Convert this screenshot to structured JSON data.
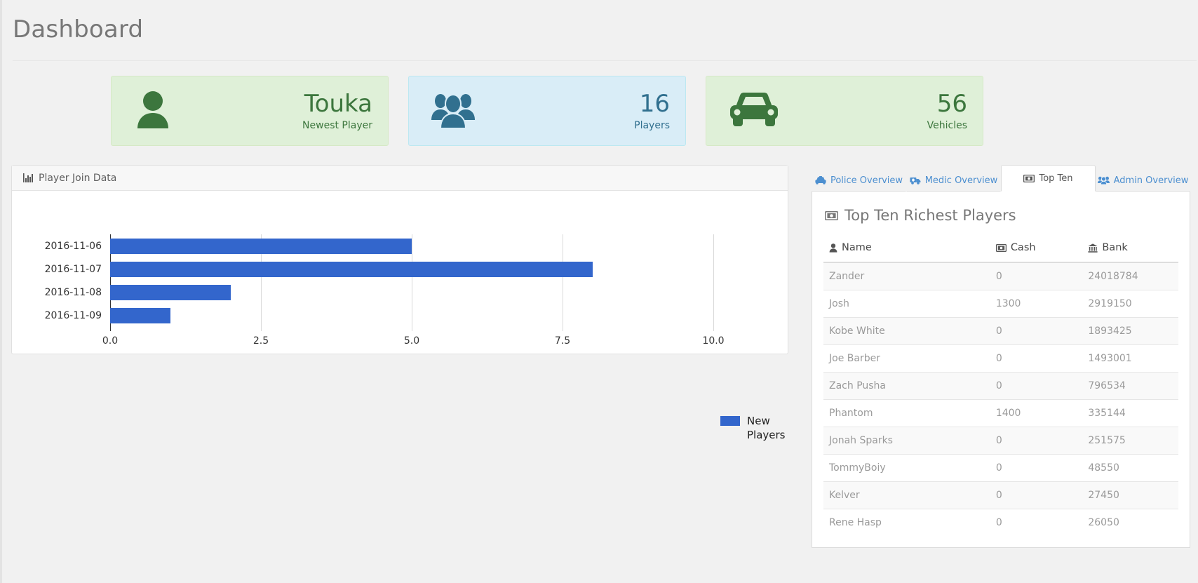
{
  "page": {
    "title": "Dashboard"
  },
  "stats": [
    {
      "icon": "user-icon",
      "value": "Touka",
      "label": "Newest Player",
      "theme": "green",
      "color": "#3c763d"
    },
    {
      "icon": "users-icon",
      "value": "16",
      "label": "Players",
      "theme": "blue",
      "color": "#31708f"
    },
    {
      "icon": "car-icon",
      "value": "56",
      "label": "Vehicles",
      "theme": "green",
      "color": "#3c763d"
    }
  ],
  "chart_panel": {
    "icon": "bar-chart-icon",
    "title": "Player Join Data"
  },
  "chart_data": {
    "type": "bar",
    "orientation": "horizontal",
    "title": "Player Join Data",
    "categories": [
      "2016-11-06",
      "2016-11-07",
      "2016-11-08",
      "2016-11-09"
    ],
    "values": [
      5,
      8,
      2,
      1
    ],
    "series": [
      {
        "name": "New Players",
        "values": [
          5,
          8,
          2,
          1
        ],
        "color": "#3366cc"
      }
    ],
    "xticks": [
      "0.0",
      "2.5",
      "5.0",
      "7.5",
      "10.0"
    ],
    "xtick_values": [
      0,
      2.5,
      5,
      7.5,
      10
    ],
    "xlim": [
      0,
      10
    ],
    "xlabel": "",
    "ylabel": "",
    "grid": true,
    "legend": {
      "position": "right",
      "entries": [
        "New Players"
      ]
    }
  },
  "tabs": [
    {
      "icon": "police-car-icon",
      "label": "Police Overview",
      "active": false
    },
    {
      "icon": "ambulance-icon",
      "label": "Medic Overview",
      "active": false
    },
    {
      "icon": "money-bill-icon",
      "label": "Top Ten",
      "active": true
    },
    {
      "icon": "users-icon",
      "label": "Admin Overview",
      "active": false
    }
  ],
  "top_ten": {
    "icon": "money-bill-icon",
    "title": "Top Ten Richest Players",
    "columns": [
      {
        "icon": "user-icon",
        "label": "Name"
      },
      {
        "icon": "money-bill-icon",
        "label": "Cash"
      },
      {
        "icon": "bank-icon",
        "label": "Bank"
      }
    ],
    "rows": [
      {
        "name": "Zander",
        "cash": "0",
        "bank": "24018784"
      },
      {
        "name": "Josh",
        "cash": "1300",
        "bank": "2919150"
      },
      {
        "name": "Kobe White",
        "cash": "0",
        "bank": "1893425"
      },
      {
        "name": "Joe Barber",
        "cash": "0",
        "bank": "1493001"
      },
      {
        "name": "Zach Pusha",
        "cash": "0",
        "bank": "796534"
      },
      {
        "name": "Phantom",
        "cash": "1400",
        "bank": "335144"
      },
      {
        "name": "Jonah Sparks",
        "cash": "0",
        "bank": "251575"
      },
      {
        "name": "TommyBoiy",
        "cash": "0",
        "bank": "48550"
      },
      {
        "name": "Kelver",
        "cash": "0",
        "bank": "27450"
      },
      {
        "name": "Rene Hasp",
        "cash": "0",
        "bank": "26050"
      }
    ]
  },
  "colors": {
    "bar": "#3366cc",
    "green_bg": "#dff0d8",
    "green_text": "#3c763d",
    "blue_bg": "#d9edf7",
    "blue_text": "#31708f",
    "link": "#4c8fd0"
  }
}
